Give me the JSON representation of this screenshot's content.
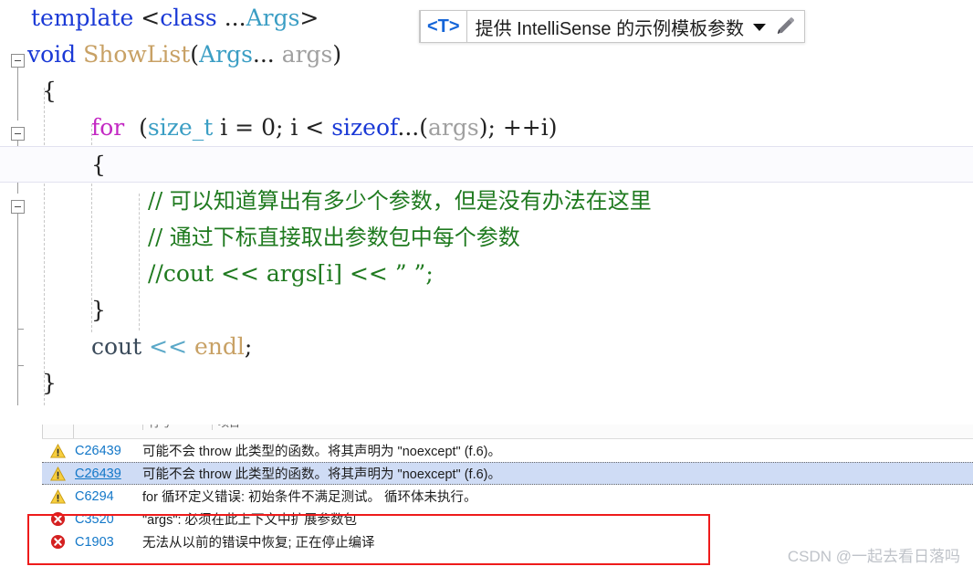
{
  "editor": {
    "lines": [
      {
        "id": "line-template",
        "segments": [
          {
            "text": "template ",
            "style": "k-blue"
          },
          {
            "text": "<",
            "style": "k-plain"
          },
          {
            "text": "class",
            "style": "k-blue"
          },
          {
            "text": " ...",
            "style": "k-plain"
          },
          {
            "text": "Args",
            "style": "k-teal"
          },
          {
            "text": ">",
            "style": "k-plain"
          }
        ],
        "plain": "template <class ...Args>"
      },
      {
        "id": "line-signature",
        "segments": [
          {
            "text": "void",
            "style": "k-blue"
          },
          {
            "text": " ",
            "style": "k-plain"
          },
          {
            "text": "ShowList",
            "style": "k-func"
          },
          {
            "text": "(",
            "style": "k-plain"
          },
          {
            "text": "Args",
            "style": "k-teal"
          },
          {
            "text": "... ",
            "style": "k-plain"
          },
          {
            "text": "args",
            "style": "k-gray"
          },
          {
            "text": ")",
            "style": "k-plain"
          }
        ],
        "plain": "void ShowList(Args... args)"
      },
      {
        "id": "line-open-brace-fn",
        "segments": [
          {
            "text": "{",
            "style": "k-plain"
          }
        ],
        "plain": "{"
      },
      {
        "id": "line-for",
        "segments": [
          {
            "text": "for",
            "style": "k-purple"
          },
          {
            "text": "  (",
            "style": "k-plain"
          },
          {
            "text": "size_t",
            "style": "k-teal"
          },
          {
            "text": " i = ",
            "style": "k-plain"
          },
          {
            "text": "0",
            "style": "k-plain"
          },
          {
            "text": "; i < ",
            "style": "k-plain"
          },
          {
            "text": "sizeof",
            "style": "k-blue"
          },
          {
            "text": "...",
            "style": "k-plain"
          },
          {
            "text": "(",
            "style": "k-plain"
          },
          {
            "text": "args",
            "style": "k-gray"
          },
          {
            "text": "); ++i)",
            "style": "k-plain"
          }
        ],
        "plain": "for  (size_t i = 0; i < sizeof...(args); ++i)"
      },
      {
        "id": "line-open-brace-for",
        "segments": [
          {
            "text": "{",
            "style": "k-plain"
          }
        ],
        "plain": "{",
        "highlighted": true
      },
      {
        "id": "line-comment-1",
        "segments": [
          {
            "text": "// 可以知道算出有多少个参数，但是没有办法在这里",
            "style": "k-comment"
          }
        ],
        "plain": "// 可以知道算出有多少个参数，但是没有办法在这里"
      },
      {
        "id": "line-comment-2",
        "segments": [
          {
            "text": "// 通过下标直接取出参数包中每个参数",
            "style": "k-comment"
          }
        ],
        "plain": "// 通过下标直接取出参数包中每个参数"
      },
      {
        "id": "line-comment-3",
        "segments": [
          {
            "text": "//cout << args[i] << \" \";",
            "style": "k-comment"
          }
        ],
        "plain": "//cout << args[i] << \" \";"
      },
      {
        "id": "line-close-brace-for",
        "segments": [
          {
            "text": "}",
            "style": "k-plain"
          }
        ],
        "plain": "}"
      },
      {
        "id": "line-cout",
        "segments": [
          {
            "text": "cout",
            "style": "k-dark"
          },
          {
            "text": " ",
            "style": "k-plain"
          },
          {
            "text": "<<",
            "style": "k-op"
          },
          {
            "text": " ",
            "style": "k-plain"
          },
          {
            "text": "endl",
            "style": "k-func"
          },
          {
            "text": ";",
            "style": "k-plain"
          }
        ],
        "plain": "cout << endl;"
      },
      {
        "id": "line-close-brace-fn",
        "segments": [
          {
            "text": "}",
            "style": "k-plain"
          }
        ],
        "plain": "}"
      }
    ]
  },
  "tooltip": {
    "template_param": "<T>",
    "message": "提供 IntelliSense 的示例模板参数",
    "dropdown_icon": "chevron-down-icon",
    "edit_icon": "pencil-icon"
  },
  "error_list": {
    "header_columns": [
      "行号",
      "项目"
    ],
    "severity_colors": {
      "warning": "#f5c518",
      "error": "#d42020"
    },
    "code_link_color": "#1277c8",
    "highlight_box_color": "#ee1b1b",
    "rows": [
      {
        "severity": "warning",
        "icon": "warning-triangle-icon",
        "code": "C26439",
        "description": "可能不会 throw 此类型的函数。将其声明为 \"noexcept\" (f.6)。",
        "selected": false
      },
      {
        "severity": "warning",
        "icon": "warning-triangle-icon",
        "code": "C26439",
        "description": "可能不会 throw 此类型的函数。将其声明为 \"noexcept\" (f.6)。",
        "selected": true
      },
      {
        "severity": "warning",
        "icon": "warning-triangle-icon",
        "code": "C6294",
        "description": "for 循环定义错误: 初始条件不满足测试。 循环体未执行。",
        "selected": false
      },
      {
        "severity": "error",
        "icon": "error-circle-icon",
        "code": "C3520",
        "description": "\"args\": 必须在此上下文中扩展参数包",
        "selected": false
      },
      {
        "severity": "error",
        "icon": "error-circle-icon",
        "code": "C1903",
        "description": "无法从以前的错误中恢复; 正在停止编译",
        "selected": false
      }
    ]
  },
  "watermark": {
    "text": "CSDN @一起去看日落吗"
  }
}
